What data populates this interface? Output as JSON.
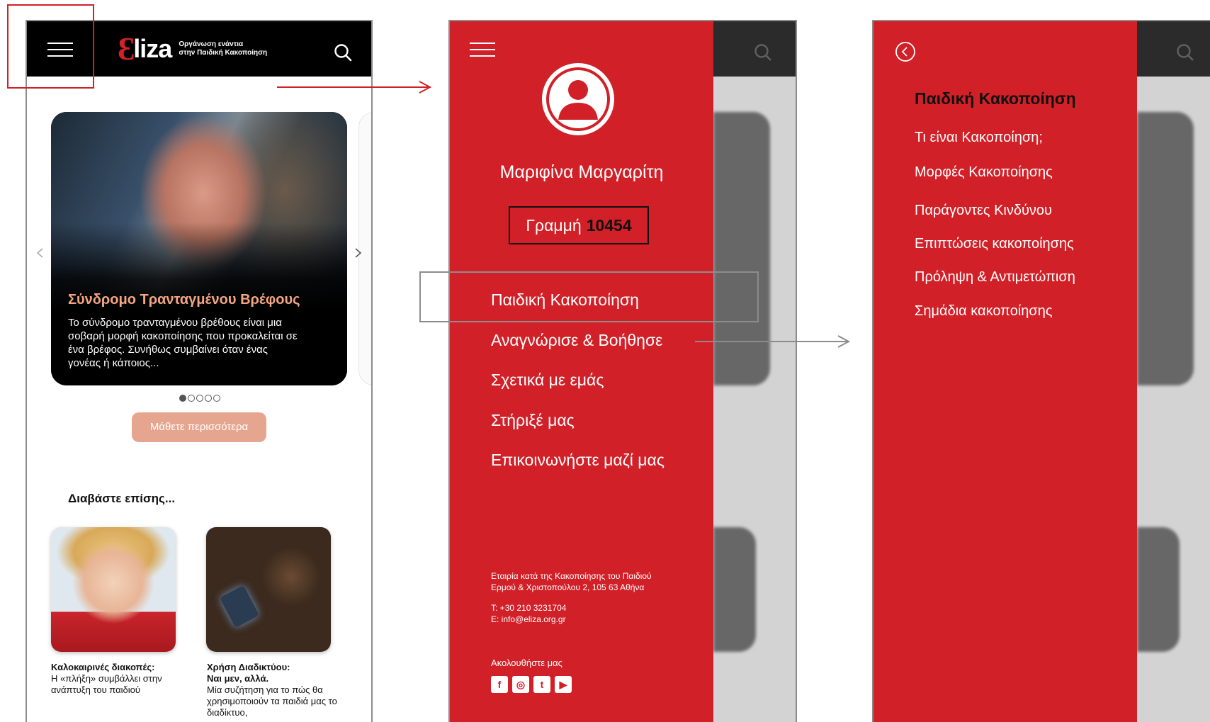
{
  "app": {
    "logo_word": "liza",
    "logo_mark": "Ɛ",
    "tagline_1": "Οργάνωση ενάντια",
    "tagline_2": "στην Παιδική Κακοποίηση"
  },
  "home": {
    "carousel": {
      "title": "Σύνδρομο Τραντανταγμένου Βρέφους",
      "title_display": "Σύνδρομο Τρανταγμένου Βρέφους",
      "text": "Το σύνδρομο τραντανταγμένου βρέθους είναι μια σοβαρή μορφή κακοποίησης που προκαλείται σε ένα βρέφος. Συνήθως συμβαίνει όταν ένας γονέας ή κάποιος...",
      "text_display": "Το σύνδρομο τρανταγμένου βρέθους είναι μια σοβαρή μορφή κακοποίησης που προκαλείται σε ένα βρέφος. Συνήθως συμβαίνει όταν ένας γονέας ή κάποιος...",
      "slide_count": 5,
      "active_slide": 1
    },
    "more_button": "Μάθετε περισσότερα",
    "read_also": "Διαβάστε επίσης...",
    "articles": [
      {
        "title": "Καλοκαιρινές διακοπές:",
        "subtitle": "Η «πλήξη» συμβάλλει στην ανάπτυξη του παιδιού"
      },
      {
        "title": "Χρήση Διαδικτύου:",
        "title2": "Ναι μεν, αλλά.",
        "subtitle": "Μία συζήτηση για το πώς θα χρησιμοποιούν τα παιδιά μας το διαδίκτυο,"
      }
    ]
  },
  "menu": {
    "profile_name": "Μαριφίνα Μαργαρίτη",
    "hotline_label": "Γραμμή",
    "hotline_number": "10454",
    "items": [
      "Παιδική Κακοποίηση",
      "Αναγνώρισε & Βοήθησε",
      "Σχετικά με εμάς",
      "Στήριξέ μας",
      "Επικοινωνήστε μαζί μας"
    ],
    "footer_org": "Εταιρία κατά της Κακοποίησης του Παιδιού",
    "footer_address": "Ερμού & Χριστοπούλου 2, 105 63 Αθήνα",
    "footer_phone": "Τ: +30 210 3231704",
    "footer_email": "Ε: info@eliza.org.gr",
    "follow_us": "Ακολουθήστε μας",
    "social": [
      "facebook-icon",
      "instagram-icon",
      "twitter-icon",
      "youtube-icon"
    ]
  },
  "submenu": {
    "heading": "Παιδική Κακοποίηση",
    "items": [
      "Τι είναι Κακοποίηση;",
      "Μορφές Κακοποίησης",
      "Παράγοντες Κινδύνου",
      "Επιπτώσεις κακοποίησης",
      "Πρόληψη & Αντιμετώπιση",
      "Σημάδια κακοποίησης"
    ]
  },
  "colors": {
    "brand_red": "#d12027",
    "accent_peach": "#e6a58f",
    "title_orange": "#f4a582",
    "annotation_grey": "#8c8c8c"
  }
}
